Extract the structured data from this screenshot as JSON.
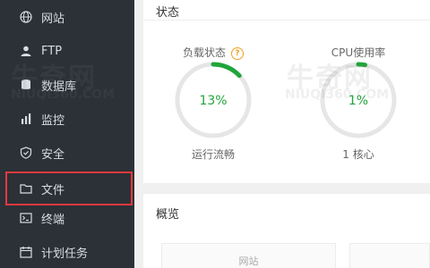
{
  "sidebar": {
    "items": [
      {
        "label": "网站",
        "icon": "globe-icon"
      },
      {
        "label": "FTP",
        "icon": "user-icon"
      },
      {
        "label": "数据库",
        "icon": "database-icon"
      },
      {
        "label": "监控",
        "icon": "monitor-icon"
      },
      {
        "label": "安全",
        "icon": "shield-icon"
      },
      {
        "label": "文件",
        "icon": "folder-icon",
        "active": true
      },
      {
        "label": "终端",
        "icon": "terminal-icon"
      },
      {
        "label": "计划任务",
        "icon": "calendar-icon"
      }
    ]
  },
  "status_panel": {
    "title": "状态",
    "load": {
      "label": "负载状态",
      "value": "13%",
      "percent": 13,
      "sub": "运行流畅"
    },
    "cpu": {
      "label": "CPU使用率",
      "value": "1%",
      "percent": 1,
      "sub": "1 核心"
    }
  },
  "overview_panel": {
    "title": "概览",
    "card_label": "网站"
  },
  "watermark": {
    "text": "牛奇网",
    "url": "NIUQI360.COM"
  },
  "colors": {
    "sidebar_bg": "#2b3136",
    "accent_green": "#20a53a",
    "highlight_red": "#e0393e",
    "help_orange": "#f0a020"
  }
}
